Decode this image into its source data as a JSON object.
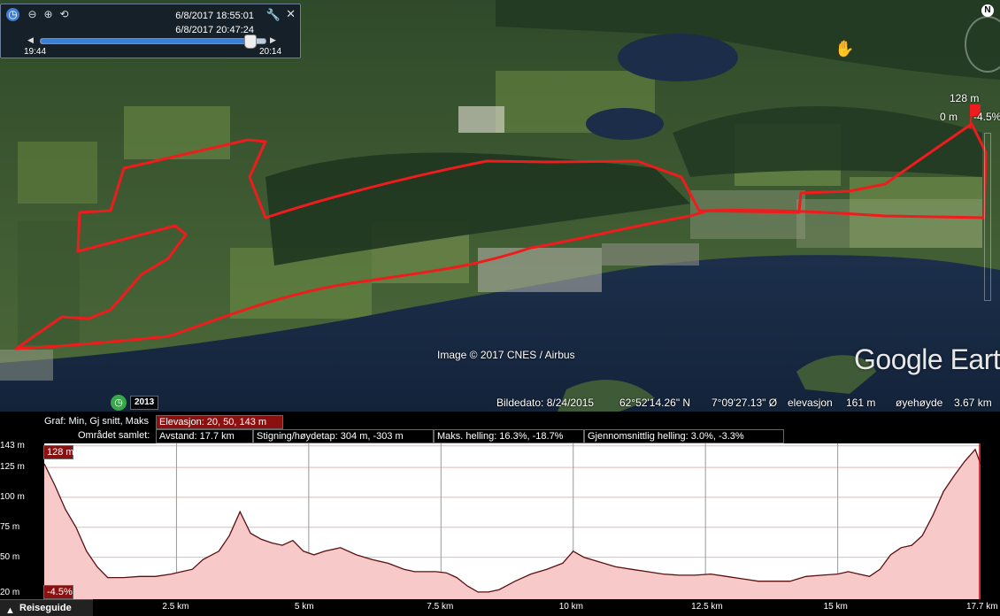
{
  "time_slider": {
    "start_datetime": "6/8/2017  18:55:01",
    "end_datetime": "6/8/2017  20:47:24",
    "left_label": "19:44",
    "right_label": "20:14",
    "position_fraction": 0.96
  },
  "compass": {
    "north_label": "N"
  },
  "route_marker": {
    "elevation": "128 m",
    "distance": "0 m",
    "slope": "-4.5%"
  },
  "map": {
    "copyright": "Image © 2017 CNES / Airbus",
    "logo": "Google Earth",
    "history_year": "2013"
  },
  "statusbar": {
    "image_date": "Bildedato: 8/24/2015",
    "latitude": "62°52'14.26\" N",
    "longitude": "7°09'27.13\" Ø",
    "elevation_label": "elevasjon",
    "elevation_value": "161 m",
    "eye_label": "øyehøyde",
    "eye_value": "3.67 km"
  },
  "profile": {
    "graph_label": "Graf: Min, Gj snitt, Maks",
    "elevation_stat": "Elevasjon: 20, 50, 143 m",
    "area_label": "Området samlet:",
    "distance_stat": "Avstand: 17.7 km",
    "climb_stat": "Stigning/høydetap: 304 m, -303 m",
    "max_slope_stat": "Maks. helling: 16.3%, -18.7%",
    "avg_slope_stat": "Gjennomsnittlig helling: 3.0%, -3.3%",
    "cursor_elevation_label": "128 m",
    "cursor_slope_label": "-4.5%"
  },
  "chart_data": {
    "type": "area",
    "xlabel": "",
    "ylabel": "",
    "x_unit": "km",
    "y_unit": "m",
    "xlim": [
      0,
      17.7
    ],
    "ylim": [
      15,
      145
    ],
    "x_ticks": [
      "2.5 km",
      "5 km",
      "7.5 km",
      "10 km",
      "12.5 km",
      "15 km",
      "17.7 km"
    ],
    "x_tick_values": [
      2.5,
      5,
      7.5,
      10,
      12.5,
      15,
      17.7
    ],
    "y_ticks": [
      "143 m",
      "125 m",
      "100 m",
      "75 m",
      "50 m",
      "20 m"
    ],
    "y_tick_values": [
      143,
      125,
      100,
      75,
      50,
      20
    ],
    "series": [
      {
        "x": [
          0,
          0.2,
          0.4,
          0.6,
          0.8,
          1.0,
          1.2,
          1.5,
          1.8,
          2.1,
          2.4,
          2.6,
          2.8,
          3.0,
          3.3,
          3.5,
          3.7,
          3.9,
          4.1,
          4.3,
          4.5,
          4.7,
          4.9,
          5.1,
          5.3,
          5.6,
          5.9,
          6.2,
          6.5,
          6.8,
          7.0,
          7.2,
          7.4,
          7.6,
          7.8,
          8.0,
          8.2,
          8.4,
          8.6,
          8.9,
          9.2,
          9.5,
          9.8,
          10.0,
          10.2,
          10.5,
          10.8,
          11.1,
          11.4,
          11.7,
          12.0,
          12.3,
          12.6,
          12.9,
          13.2,
          13.5,
          13.8,
          14.1,
          14.4,
          14.7,
          15.0,
          15.2,
          15.4,
          15.6,
          15.8,
          16.0,
          16.2,
          16.4,
          16.6,
          16.8,
          17.0,
          17.2,
          17.4,
          17.6,
          17.7
        ],
        "y": [
          128,
          110,
          90,
          75,
          55,
          42,
          33,
          33,
          34,
          34,
          36,
          38,
          40,
          48,
          55,
          68,
          88,
          70,
          65,
          62,
          60,
          64,
          55,
          52,
          55,
          58,
          52,
          48,
          45,
          40,
          38,
          38,
          38,
          37,
          33,
          26,
          21,
          21,
          23,
          30,
          36,
          40,
          45,
          55,
          50,
          46,
          42,
          40,
          38,
          36,
          35,
          35,
          36,
          34,
          32,
          30,
          30,
          30,
          34,
          35,
          36,
          38,
          36,
          34,
          40,
          52,
          58,
          60,
          68,
          85,
          105,
          118,
          130,
          140,
          128
        ]
      }
    ],
    "grid": true,
    "fill_color": "#f7c9c9",
    "line_color": "#5a1010"
  }
}
